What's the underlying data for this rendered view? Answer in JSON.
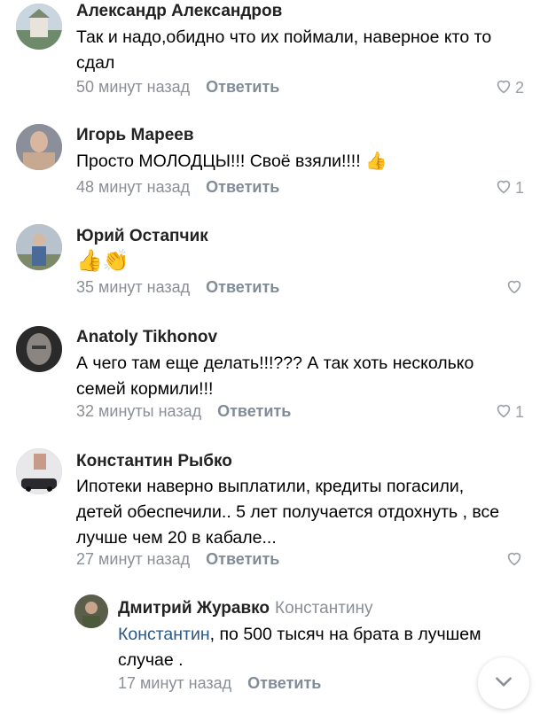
{
  "comments": [
    {
      "author": "Александр Александров",
      "text": "Так и надо,обидно что их поймали, наверное кто то сдал",
      "time": "50 минут назад",
      "reply_label": "Ответить",
      "likes": "2"
    },
    {
      "author": "Игорь Мареев",
      "text": "Просто МОЛОДЦЫ!!! Своё взяли!!!! 👍",
      "time": "48 минут назад",
      "reply_label": "Ответить",
      "likes": "1"
    },
    {
      "author": "Юрий Остапчик",
      "text": "👍👏",
      "time": "35 минут назад",
      "reply_label": "Ответить",
      "likes": ""
    },
    {
      "author": "Anatoly Tikhonov",
      "text": "А чего там еще делать!!!???  А так хоть несколько семей кормили!!!",
      "time": "32 минуты назад",
      "reply_label": "Ответить",
      "likes": "1"
    },
    {
      "author": "Константин Рыбко",
      "text": "Ипотеки наверно выплатили, кредиты погасили, детей обеспечили.. 5 лет получается отдохнуть , все лучше чем 20 в кабале...",
      "time": "27 минут назад",
      "reply_label": "Ответить",
      "likes": ""
    }
  ],
  "reply": {
    "author": "Дмитрий Журавко",
    "reply_to": "Константину",
    "mention": "Константин",
    "text": ", по 500 тысяч на брата в лучшем случае .",
    "time": "17 минут назад",
    "reply_label": "Ответить"
  },
  "icons": {
    "like": "heart-icon",
    "scroll": "chevron-down-icon"
  },
  "colors": {
    "link": "#2a5885",
    "meta": "#8a8f96",
    "reply_button": "#818c99"
  }
}
